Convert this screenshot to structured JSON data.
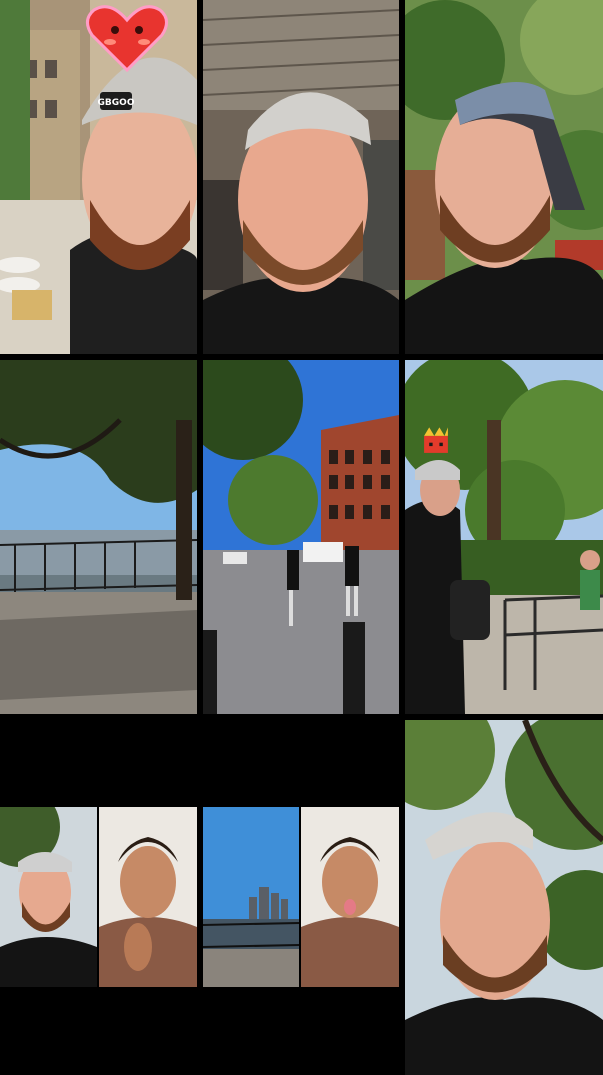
{
  "collage": {
    "background": "#000000",
    "tiles": [
      {
        "id": "tile-1",
        "scene": "selfie-cap-heart-sticker",
        "sticker": "heart-face-sticker",
        "cap_logo_text": "GBGOO"
      },
      {
        "id": "tile-2",
        "scene": "selfie-backwards-cap-under-awning"
      },
      {
        "id": "tile-3",
        "scene": "selfie-profile-cap-trees"
      },
      {
        "id": "tile-4",
        "scene": "waterfront-promenade-tree-shade"
      },
      {
        "id": "tile-5",
        "scene": "street-red-brick-building-people"
      },
      {
        "id": "tile-6",
        "scene": "park-man-backpack-sticker",
        "sticker": "pixel-crown-sticker"
      },
      {
        "id": "tile-7",
        "scene": "split-selfie-and-tattooed-man"
      },
      {
        "id": "tile-8",
        "scene": "split-skyline-and-tattooed-man-tongue"
      },
      {
        "id": "tile-9",
        "scene": "selfie-backwards-cap-trees"
      }
    ]
  }
}
